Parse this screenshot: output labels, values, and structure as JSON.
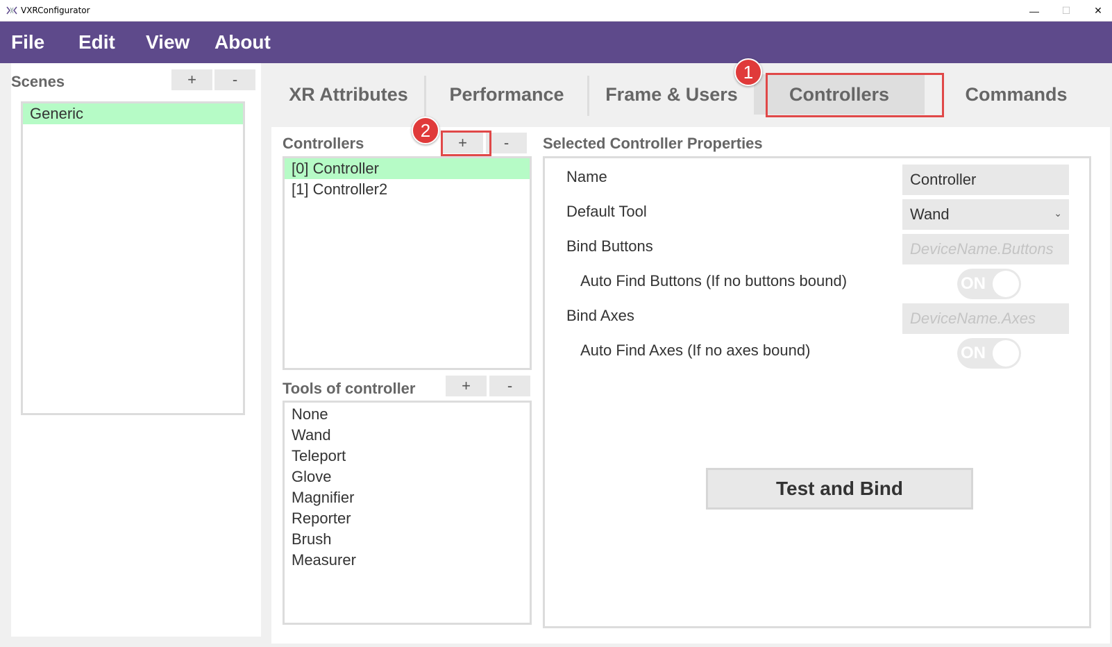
{
  "window": {
    "title": "VXRConfigurator",
    "minimize": "—",
    "maximize": "☐",
    "close": "✕"
  },
  "menu": {
    "file": "File",
    "edit": "Edit",
    "view": "View",
    "about": "About"
  },
  "scenes": {
    "label": "Scenes",
    "add": "+",
    "remove": "-",
    "items": [
      "Generic"
    ],
    "selected_index": 0
  },
  "tabs": [
    {
      "label": "XR Attributes"
    },
    {
      "label": "Performance"
    },
    {
      "label": "Frame & Users"
    },
    {
      "label": "Controllers"
    },
    {
      "label": "Commands"
    }
  ],
  "active_tab": "Controllers",
  "controllers": {
    "label": "Controllers",
    "add": "+",
    "remove": "-",
    "items": [
      "[0] Controller",
      "[1] Controller2"
    ],
    "selected_index": 0
  },
  "tools": {
    "label": "Tools of controller",
    "add": "+",
    "remove": "-",
    "items": [
      "None",
      "Wand",
      "Teleport",
      "Glove",
      "Magnifier",
      "Reporter",
      "Brush",
      "Measurer"
    ]
  },
  "properties": {
    "label": "Selected Controller Properties",
    "name_label": "Name",
    "name_value": "Controller",
    "default_tool_label": "Default Tool",
    "default_tool_value": "Wand",
    "bind_buttons_label": "Bind Buttons",
    "bind_buttons_placeholder": "DeviceName.Buttons",
    "auto_find_buttons_label": "Auto Find Buttons (If no buttons bound)",
    "auto_find_buttons_state": "ON",
    "bind_axes_label": "Bind Axes",
    "bind_axes_placeholder": "DeviceName.Axes",
    "auto_find_axes_label": "Auto Find Axes (If no axes bound)",
    "auto_find_axes_state": "ON",
    "test_bind_button": "Test and Bind"
  },
  "annotations": {
    "badge1": "1",
    "badge2": "2"
  },
  "colors": {
    "menubar": "#5e4a8b",
    "selected_row": "#b6fbc6",
    "annotation": "#e04848"
  }
}
